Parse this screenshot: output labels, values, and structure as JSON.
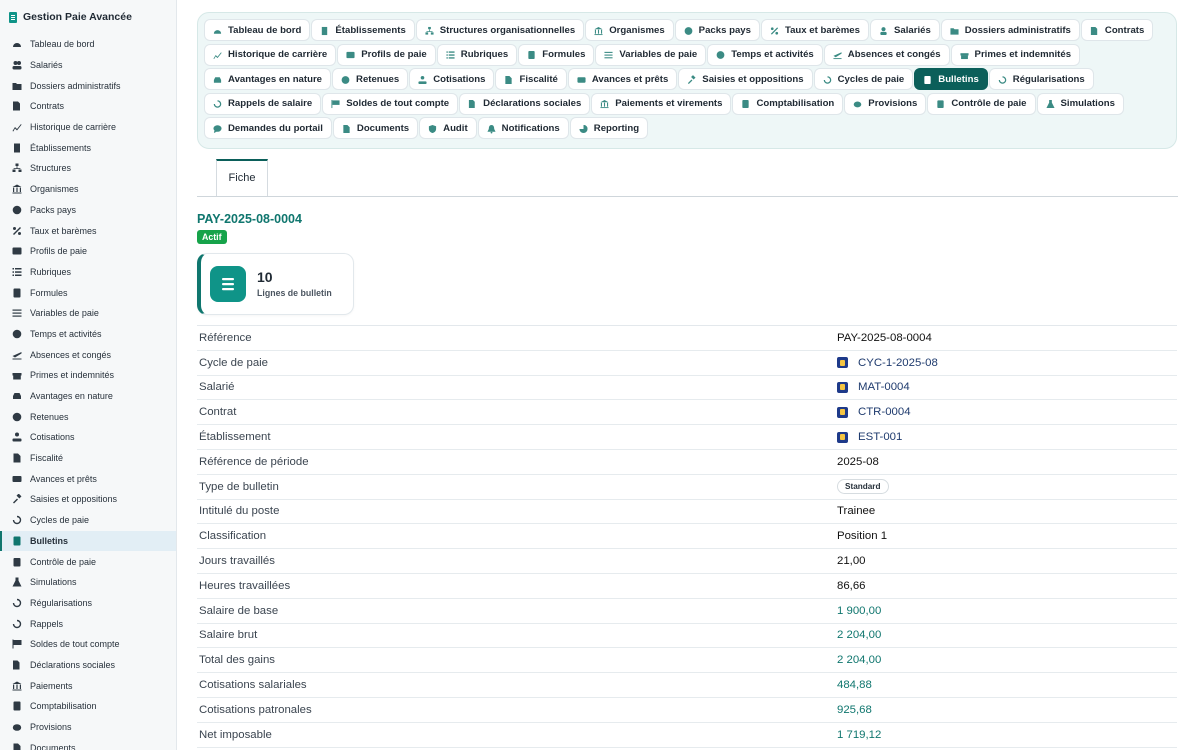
{
  "sidebar": {
    "brand": "Gestion Paie Avancée",
    "items": [
      {
        "label": "Tableau de bord",
        "icon": "gauge-icon"
      },
      {
        "label": "Salariés",
        "icon": "users-icon"
      },
      {
        "label": "Dossiers administratifs",
        "icon": "folder-icon"
      },
      {
        "label": "Contrats",
        "icon": "contract-icon"
      },
      {
        "label": "Historique de carrière",
        "icon": "chart-line-icon"
      },
      {
        "label": "Établissements",
        "icon": "building-icon"
      },
      {
        "label": "Structures",
        "icon": "sitemap-icon"
      },
      {
        "label": "Organismes",
        "icon": "institution-icon"
      },
      {
        "label": "Packs pays",
        "icon": "globe-icon"
      },
      {
        "label": "Taux et barèmes",
        "icon": "percent-icon"
      },
      {
        "label": "Profils de paie",
        "icon": "id-card-icon"
      },
      {
        "label": "Rubriques",
        "icon": "list-icon"
      },
      {
        "label": "Formules",
        "icon": "calculator-icon"
      },
      {
        "label": "Variables de paie",
        "icon": "sliders-icon"
      },
      {
        "label": "Temps et activités",
        "icon": "clock-icon"
      },
      {
        "label": "Absences et congés",
        "icon": "plane-icon"
      },
      {
        "label": "Primes et indemnités",
        "icon": "gift-icon"
      },
      {
        "label": "Avantages en nature",
        "icon": "car-icon"
      },
      {
        "label": "Retenues",
        "icon": "minus-circle-icon"
      },
      {
        "label": "Cotisations",
        "icon": "hand-coin-icon"
      },
      {
        "label": "Fiscalité",
        "icon": "tax-doc-icon"
      },
      {
        "label": "Avances et prêts",
        "icon": "money-icon"
      },
      {
        "label": "Saisies et oppositions",
        "icon": "gavel-icon"
      },
      {
        "label": "Cycles de paie",
        "icon": "refresh-icon"
      },
      {
        "label": "Bulletins",
        "icon": "receipt-icon",
        "active": true
      },
      {
        "label": "Contrôle de paie",
        "icon": "clipboard-check-icon"
      },
      {
        "label": "Simulations",
        "icon": "flask-icon"
      },
      {
        "label": "Régularisations",
        "icon": "undo-icon"
      },
      {
        "label": "Rappels",
        "icon": "history-icon"
      },
      {
        "label": "Soldes de tout compte",
        "icon": "flag-checkered-icon"
      },
      {
        "label": "Déclarations sociales",
        "icon": "file-export-icon"
      },
      {
        "label": "Paiements",
        "icon": "bank-icon"
      },
      {
        "label": "Comptabilisation",
        "icon": "ledger-icon"
      },
      {
        "label": "Provisions",
        "icon": "piggy-icon"
      },
      {
        "label": "Documents",
        "icon": "file-icon"
      }
    ]
  },
  "tabs": [
    {
      "label": "Tableau de bord",
      "icon": "gauge-icon"
    },
    {
      "label": "Établissements",
      "icon": "building-icon"
    },
    {
      "label": "Structures organisationnelles",
      "icon": "sitemap-icon"
    },
    {
      "label": "Organismes",
      "icon": "institution-icon"
    },
    {
      "label": "Packs pays",
      "icon": "globe-icon"
    },
    {
      "label": "Taux et barèmes",
      "icon": "percent-icon"
    },
    {
      "label": "Salariés",
      "icon": "user-icon"
    },
    {
      "label": "Dossiers administratifs",
      "icon": "folder-icon"
    },
    {
      "label": "Contrats",
      "icon": "contract-icon"
    },
    {
      "label": "Historique de carrière",
      "icon": "chart-line-icon"
    },
    {
      "label": "Profils de paie",
      "icon": "id-card-icon"
    },
    {
      "label": "Rubriques",
      "icon": "list-icon"
    },
    {
      "label": "Formules",
      "icon": "calculator-icon"
    },
    {
      "label": "Variables de paie",
      "icon": "sliders-icon"
    },
    {
      "label": "Temps et activités",
      "icon": "clock-icon"
    },
    {
      "label": "Absences et congés",
      "icon": "plane-icon"
    },
    {
      "label": "Primes et indemnités",
      "icon": "gift-icon"
    },
    {
      "label": "Avantages en nature",
      "icon": "car-icon"
    },
    {
      "label": "Retenues",
      "icon": "minus-circle-icon"
    },
    {
      "label": "Cotisations",
      "icon": "hand-coin-icon"
    },
    {
      "label": "Fiscalité",
      "icon": "tax-doc-icon"
    },
    {
      "label": "Avances et prêts",
      "icon": "money-icon"
    },
    {
      "label": "Saisies et oppositions",
      "icon": "gavel-icon"
    },
    {
      "label": "Cycles de paie",
      "icon": "refresh-icon"
    },
    {
      "label": "Bulletins",
      "icon": "receipt-icon",
      "active": true
    },
    {
      "label": "Régularisations",
      "icon": "undo-icon"
    },
    {
      "label": "Rappels de salaire",
      "icon": "history-icon"
    },
    {
      "label": "Soldes de tout compte",
      "icon": "flag-checkered-icon"
    },
    {
      "label": "Déclarations sociales",
      "icon": "file-export-icon"
    },
    {
      "label": "Paiements et virements",
      "icon": "bank-icon"
    },
    {
      "label": "Comptabilisation",
      "icon": "ledger-icon"
    },
    {
      "label": "Provisions",
      "icon": "piggy-icon"
    },
    {
      "label": "Contrôle de paie",
      "icon": "clipboard-check-icon"
    },
    {
      "label": "Simulations",
      "icon": "flask-icon"
    },
    {
      "label": "Demandes du portail",
      "icon": "comment-icon"
    },
    {
      "label": "Documents",
      "icon": "file-icon"
    },
    {
      "label": "Audit",
      "icon": "shield-icon"
    },
    {
      "label": "Notifications",
      "icon": "bell-icon"
    },
    {
      "label": "Reporting",
      "icon": "pie-icon"
    }
  ],
  "subtab": "Fiche",
  "record": {
    "title": "PAY-2025-08-0004",
    "status": "Actif",
    "stat_value": "10",
    "stat_label": "Lignes de bulletin"
  },
  "rows": [
    {
      "key": "Référence",
      "value": "PAY-2025-08-0004",
      "kind": "plain"
    },
    {
      "key": "Cycle de paie",
      "value": "CYC-1-2025-08",
      "kind": "link"
    },
    {
      "key": "Salarié",
      "value": "MAT-0004",
      "kind": "link"
    },
    {
      "key": "Contrat",
      "value": "CTR-0004",
      "kind": "link"
    },
    {
      "key": "Établissement",
      "value": "EST-001",
      "kind": "link"
    },
    {
      "key": "Référence de période",
      "value": "2025-08",
      "kind": "plain"
    },
    {
      "key": "Type de bulletin",
      "value": "Standard",
      "kind": "pill"
    },
    {
      "key": "Intitulé du poste",
      "value": "Trainee",
      "kind": "plain"
    },
    {
      "key": "Classification",
      "value": "Position 1",
      "kind": "plain"
    },
    {
      "key": "Jours travaillés",
      "value": "21,00",
      "kind": "plain"
    },
    {
      "key": "Heures travaillées",
      "value": "86,66",
      "kind": "plain"
    },
    {
      "key": "Salaire de base",
      "value": "1 900,00",
      "kind": "teal"
    },
    {
      "key": "Salaire brut",
      "value": "2 204,00",
      "kind": "teal"
    },
    {
      "key": "Total des gains",
      "value": "2 204,00",
      "kind": "teal"
    },
    {
      "key": "Cotisations salariales",
      "value": "484,88",
      "kind": "teal"
    },
    {
      "key": "Cotisations patronales",
      "value": "925,68",
      "kind": "teal"
    },
    {
      "key": "Net imposable",
      "value": "1 719,12",
      "kind": "teal"
    }
  ],
  "colors": {
    "accent": "#0f766e",
    "active_tab": "#0b5f5a",
    "badge": "#16a34a"
  }
}
